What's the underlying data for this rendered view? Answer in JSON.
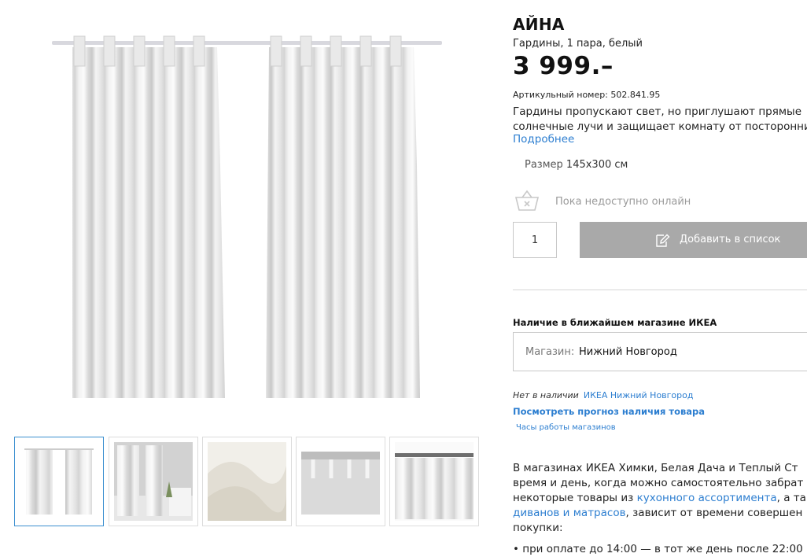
{
  "product": {
    "name": "АЙНА",
    "subtitle": "Гардины, 1 пара, белый",
    "price": "3 999.–",
    "article": "Артикульный номер: 502.841.95",
    "description_line1": "Гардины пропускают свет, но приглушают прямые",
    "description_line2": "солнечные лучи и защищает комнату от посторонних г",
    "more_link": "Подробнее",
    "size_label": "Размер",
    "size_value": "145x300 см"
  },
  "availability": {
    "online_status": "Пока недоступно онлайн",
    "quantity": "1",
    "add_button": "Добавить в список"
  },
  "store": {
    "title": "Наличие в ближайшем магазине ИКЕА",
    "select_label": "Магазин:",
    "select_value": "Нижний Новгород",
    "stock_status": "Нет в наличии",
    "stock_store": "ИКЕА Нижний Новгород",
    "forecast_link": "Посмотреть прогноз наличия товара",
    "hours_link": "Часы работы магазинов"
  },
  "delivery": {
    "line1": "В магазинах ИКЕА Химки, Белая Дача и Теплый Ст",
    "line2": "время и день, когда можно самостоятельно забрат",
    "line3_pre": "некоторые товары из ",
    "line3_link": "кухонного ассортимента",
    "line3_post": ", а та",
    "line4_link": "диванов и матрасов",
    "line4_post": ", зависит от времени совершен",
    "line5": "покупки:",
    "bullet": "• при оплате до 14:00 — в тот же день после 22:00"
  },
  "gallery": {
    "thumbnails": [
      "curtains-front-view",
      "curtains-in-room",
      "fabric-closeup",
      "heading-tape-detail",
      "curtain-rod-detail"
    ],
    "active_index": 0
  },
  "colors": {
    "link": "#2c7ed0",
    "button_disabled": "#a9a9a9",
    "active_thumb_border": "#3b8fd0"
  }
}
